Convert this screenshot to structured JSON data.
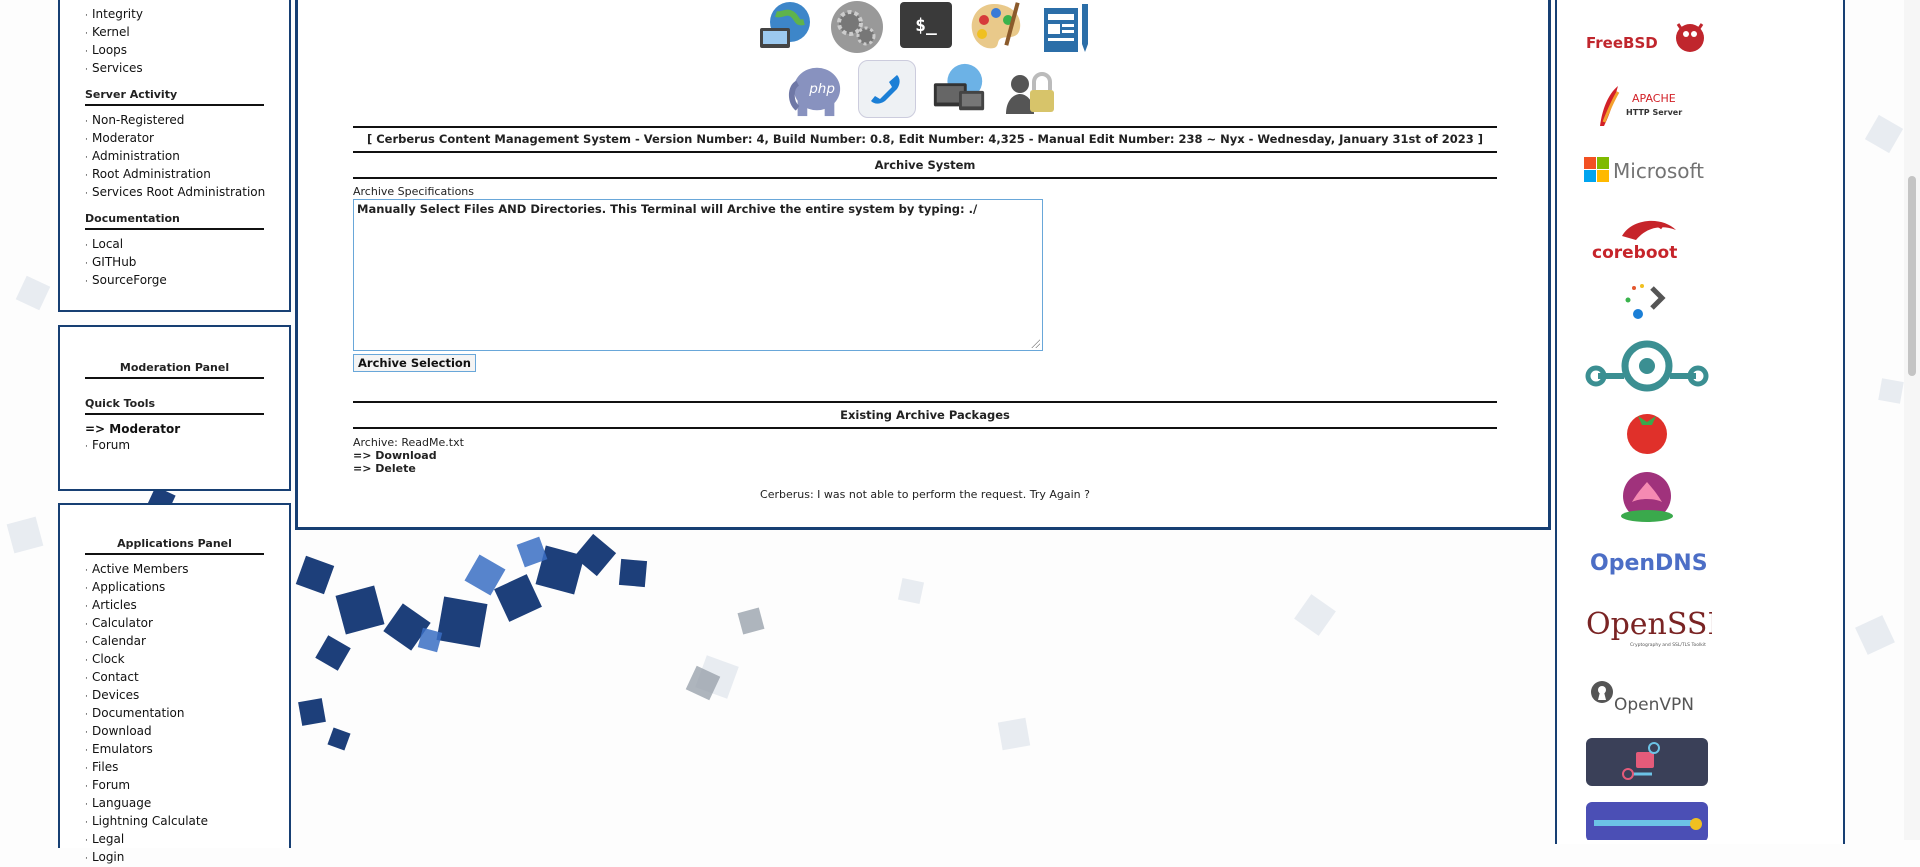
{
  "colors": {
    "panel_border": "#173f73",
    "accent_blue": "#69a7d9"
  },
  "left": {
    "top_items": [
      "Integrity",
      "Kernel",
      "Loops",
      "Services"
    ],
    "server_activity": {
      "heading": "Server Activity",
      "items": [
        "Non-Registered",
        "Moderator",
        "Administration",
        "Root Administration",
        "Services Root Administration"
      ]
    },
    "documentation": {
      "heading": "Documentation",
      "items": [
        "Local",
        "GITHub",
        "SourceForge"
      ]
    },
    "moderation": {
      "title": "Moderation Panel",
      "quick_tools": "Quick Tools",
      "moderator_link": "=> Moderator",
      "forum": "Forum"
    },
    "applications": {
      "title": "Applications Panel",
      "items": [
        "Active Members",
        "Applications",
        "Articles",
        "Calculator",
        "Calendar",
        "Clock",
        "Contact",
        "Devices",
        "Documentation",
        "Download",
        "Emulators",
        "Files",
        "Forum",
        "Language",
        "Lightning Calculate",
        "Legal",
        "Login"
      ]
    }
  },
  "main": {
    "icons_row1": [
      "globe-computer-icon",
      "gears-icon",
      "terminal-icon",
      "palette-icon",
      "document-edit-icon"
    ],
    "icons_row2": [
      "php-elephant-icon",
      "phone-icon",
      "network-computers-icon",
      "user-lock-icon"
    ],
    "terminal_glyph": "$_",
    "php_glyph": "php",
    "banner": "[ Cerberus Content Management System - Version Number: 4, Build Number: 0.8, Edit Number: 4,325 - Manual Edit Number: 238 ~ Nyx - Wednesday, January 31st of 2023 ]",
    "archive_system": "Archive System",
    "spec_label": "Archive Specifications",
    "spec_text": "Manually Select Files AND Directories. This Terminal will Archive the entire system by typing: ./",
    "archive_button": "Archive Selection",
    "existing_heading": "Existing Archive Packages",
    "archive_name": "Archive: ReadMe.txt",
    "download": "=> Download",
    "delete": "=> Delete",
    "status": "Cerberus: I was not able to perform the request. Try Again ?"
  },
  "logos": {
    "freebsd": "FreeBSD",
    "apache": "APACHE",
    "apache_sub": "HTTP Server",
    "microsoft": "Microsoft",
    "coreboot": "coreboot",
    "opendns": "OpenDNS",
    "openssl": "OpenSSL",
    "openssl_sub": "Cryptography and SSL/TLS Toolkit",
    "openvpn": "OpenVPN"
  }
}
